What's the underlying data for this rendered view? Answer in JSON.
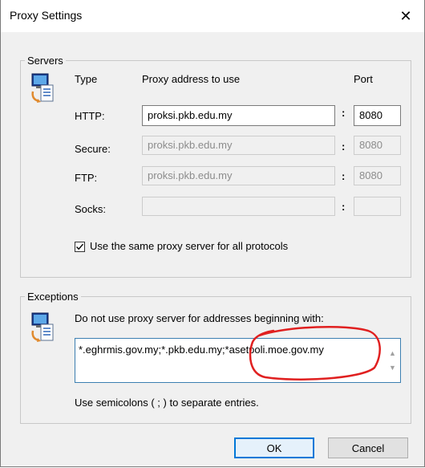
{
  "window": {
    "title": "Proxy Settings",
    "close_glyph": "✕"
  },
  "servers": {
    "legend": "Servers",
    "col_type": "Type",
    "col_address": "Proxy address to use",
    "col_port": "Port",
    "colon": ":",
    "rows": [
      {
        "label": "HTTP:",
        "address": "proksi.pkb.edu.my",
        "port": "8080",
        "enabled": true
      },
      {
        "label": "Secure:",
        "address": "proksi.pkb.edu.my",
        "port": "8080",
        "enabled": false
      },
      {
        "label": "FTP:",
        "address": "proksi.pkb.edu.my",
        "port": "8080",
        "enabled": false
      },
      {
        "label": "Socks:",
        "address": "",
        "port": "",
        "enabled": false
      }
    ],
    "same_proxy_label": "Use the same proxy server for all protocols",
    "same_proxy_checked": true
  },
  "exceptions": {
    "legend": "Exceptions",
    "instruction": "Do not use proxy server for addresses beginning with:",
    "value": "*.eghrmis.gov.my;*.pkb.edu.my;*asetpoli.moe.gov.my",
    "hint": "Use semicolons ( ; ) to separate entries."
  },
  "buttons": {
    "ok": "OK",
    "cancel": "Cancel"
  },
  "colors": {
    "annotation_red": "#e02020",
    "focus_blue": "#0078d7"
  }
}
